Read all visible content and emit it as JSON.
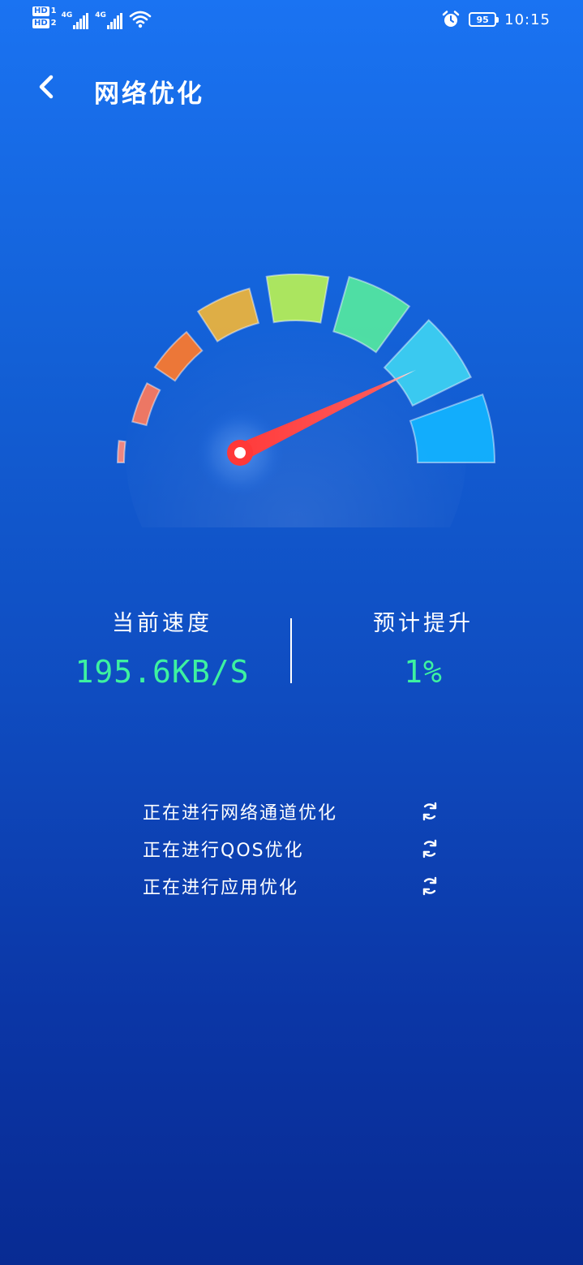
{
  "status_bar": {
    "sim1_badge": "HD",
    "sim1_index": "1",
    "sim2_badge": "HD",
    "sim2_index": "2",
    "network1": "4G",
    "network2": "4G",
    "battery_level": "95",
    "time": "10:15"
  },
  "header": {
    "title": "网络优化"
  },
  "gauge": {
    "needle_fraction": 0.86,
    "segment_count": 8
  },
  "stats": {
    "current_speed_label": "当前速度",
    "current_speed_value": "195.6KB/S",
    "expected_boost_label": "预计提升",
    "expected_boost_value": "1%"
  },
  "tasks": [
    {
      "label": "正在进行网络通道优化",
      "icon": "refresh-icon"
    },
    {
      "label": "正在进行QOS优化",
      "icon": "refresh-icon"
    },
    {
      "label": "正在进行应用优化",
      "icon": "refresh-icon"
    }
  ],
  "colors": {
    "accent_green": "#3df2a0",
    "background_top": "#1a73f2",
    "background_bottom": "#082b93"
  }
}
